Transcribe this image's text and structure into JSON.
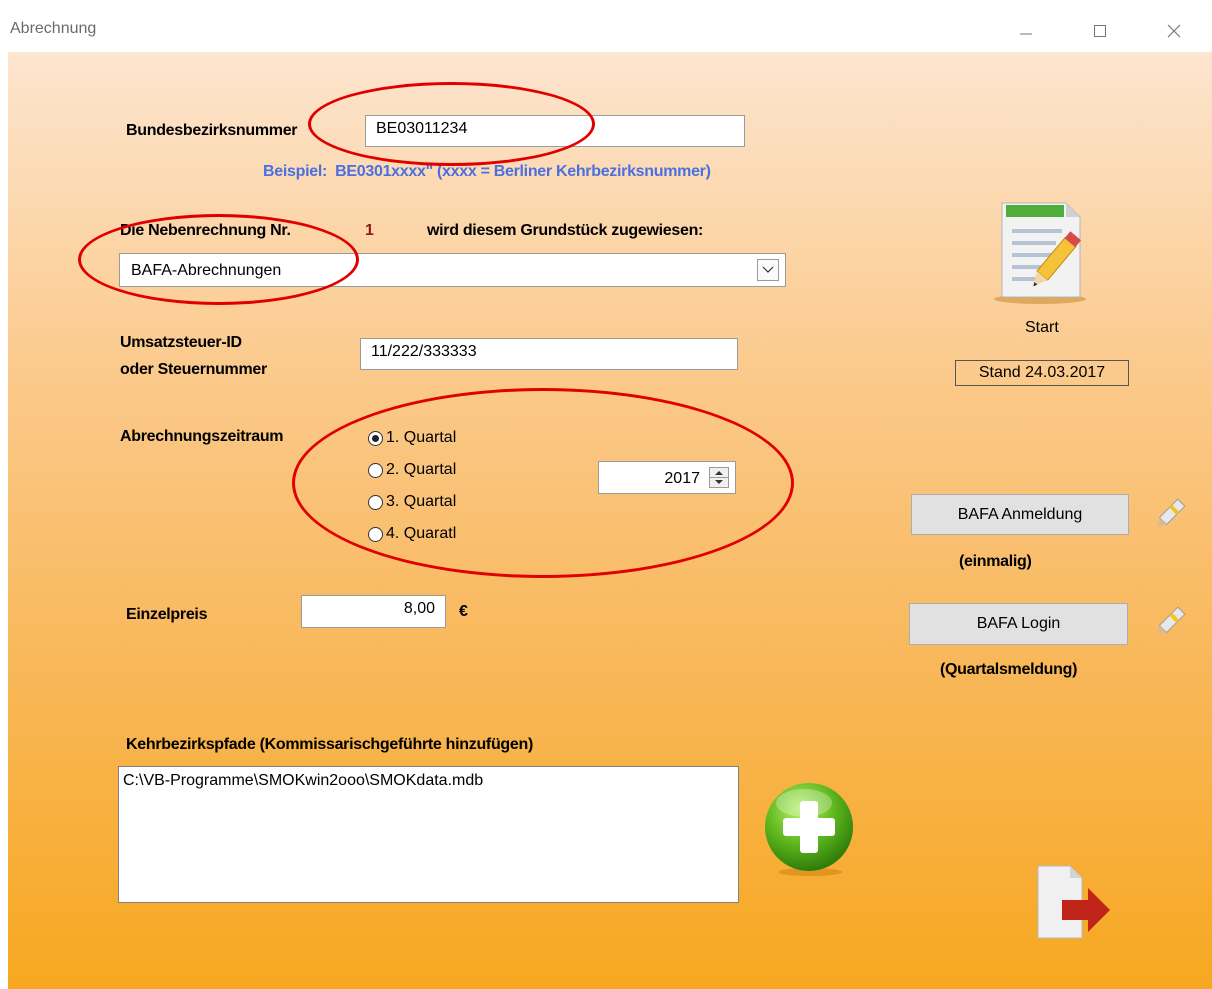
{
  "window": {
    "title": "Abrechnung",
    "controls": {
      "minimize": "—",
      "maximize": "☐",
      "close": "✕"
    }
  },
  "form": {
    "bundesbezirk_label": "Bundesbezirksnummer",
    "bundesbezirk_value": "BE03011234",
    "beispiel_prefix": "Beispiel:",
    "beispiel_text": "BE0301xxxx\" (xxxx = Berliner Kehrbezirksnummer)",
    "nebenrechnung_label": "Die Nebenrechnung Nr.",
    "nebenrechnung_nr": "1",
    "zugewiesen_label": "wird diesem Grundstück zugewiesen:",
    "dropdown_value": "BAFA-Abrechnungen",
    "ust_label_line1": "Umsatzsteuer-ID",
    "ust_label_line2": "oder Steuernummer",
    "ust_value": "11/222/333333",
    "zeitraum_label": "Abrechnungszeitraum",
    "quartale": [
      {
        "label": "1. Quartal",
        "selected": true
      },
      {
        "label": "2. Quartal",
        "selected": false
      },
      {
        "label": "3. Quartal",
        "selected": false
      },
      {
        "label": "4. Quaratl",
        "selected": false
      }
    ],
    "year_value": "2017",
    "einzelpreis_label": "Einzelpreis",
    "einzelpreis_value": "8,00",
    "currency": "€",
    "pfade_label": "Kehrbezirkspfade (Kommissarischgeführte hinzufügen)",
    "pfade_items": [
      "C:\\VB-Programme\\SMOKwin2ooo\\SMOKdata.mdb"
    ]
  },
  "side": {
    "start_label": "Start",
    "stand_label": "Stand 24.03.2017",
    "anmeldung_button": "BAFA Anmeldung",
    "anmeldung_note": "(einmalig)",
    "login_button": "BAFA Login",
    "login_note": "(Quartalsmeldung)"
  },
  "colors": {
    "annotation": "#e00000",
    "example_text": "#4a6fe0",
    "number_red": "#8b1a1a",
    "bg_top": "#fde5cf",
    "bg_bottom": "#f7a820"
  }
}
